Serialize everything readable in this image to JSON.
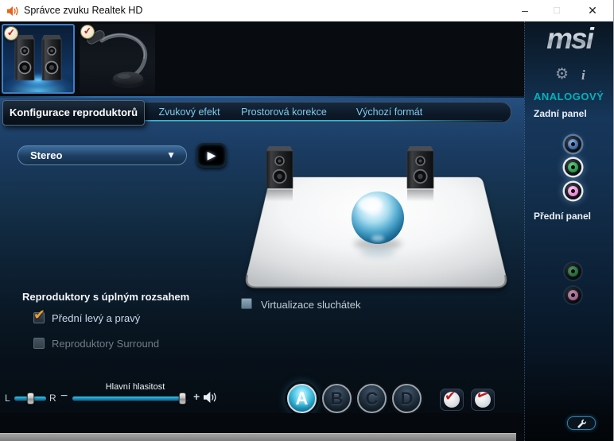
{
  "window": {
    "title": "Správce zvuku Realtek HD",
    "controls": {
      "minimize": "–",
      "maximize": "□",
      "close": "✕"
    }
  },
  "brand": {
    "logo": "msi"
  },
  "device_tabs": {
    "speakers": {
      "checked": true,
      "selected": true
    },
    "microphone": {
      "checked": true,
      "selected": false
    }
  },
  "nav_tabs": [
    {
      "label": "Konfigurace reproduktorů",
      "active": true
    },
    {
      "label": "Zvukový efekt",
      "active": false
    },
    {
      "label": "Prostorová korekce",
      "active": false
    },
    {
      "label": "Výchozí formát",
      "active": false
    }
  ],
  "speaker_config": {
    "channel_value": "Stereo",
    "full_range_heading": "Reproduktory s úplným rozsahem",
    "front_pair_label": "Přední levý a pravý",
    "front_pair_checked": true,
    "surround_label": "Reproduktory Surround",
    "surround_checked": false,
    "virtualization_label": "Virtualizace sluchátek",
    "virtualization_checked": false
  },
  "volume": {
    "label": "Hlavní hlasitost",
    "left": "L",
    "right": "R",
    "minus": "−",
    "plus": "+",
    "balance_percent": 50,
    "level_percent": 95
  },
  "profiles": {
    "a": "A",
    "b": "B",
    "c": "C",
    "d": "D",
    "selected": "A"
  },
  "sidebar": {
    "analog_heading": "ANALOGOVÝ",
    "back_panel_label": "Zadní panel",
    "front_panel_label": "Přední panel"
  },
  "icons": {
    "check": "✔",
    "play": "▶",
    "dropdown_arrow": "▼",
    "gear": "⚙",
    "info": "i"
  },
  "colors": {
    "accent_cyan": "#35b0dd",
    "analog_teal": "#00b4ba",
    "check_red": "#c21a1a",
    "check_orange": "#f49c2c",
    "brand_silver": "#d9dee3",
    "tab_text_blue": "#7ecbee"
  }
}
